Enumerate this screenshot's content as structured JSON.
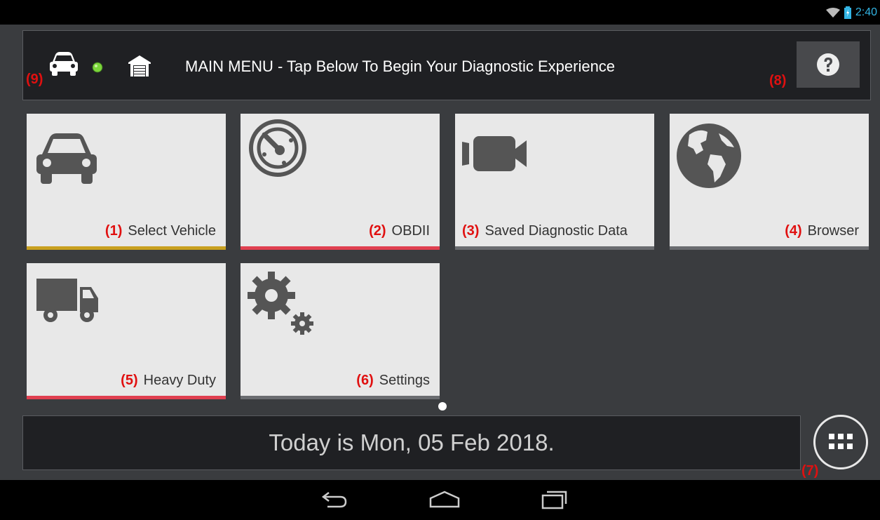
{
  "status_bar": {
    "time": "2:40",
    "icons": [
      "wifi-icon",
      "battery-icon"
    ]
  },
  "header": {
    "title": "MAIN MENU - Tap Below To Begin Your Diagnostic Experience",
    "status_led_color": "#7bd63a",
    "annotation_vehicle": "(9)",
    "annotation_help": "(8)",
    "help_icon": "question-icon"
  },
  "tiles": [
    {
      "number": "(1)",
      "label": "Select Vehicle",
      "icon": "car-icon",
      "accent": "#c8a020"
    },
    {
      "number": "(2)",
      "label": "OBDII",
      "icon": "gauge-icon",
      "accent": "#e04050"
    },
    {
      "number": "(3)",
      "label": "Saved Diagnostic Data",
      "icon": "video-camera-icon",
      "accent": "#6a6c70"
    },
    {
      "number": "(4)",
      "label": "Browser",
      "icon": "globe-icon",
      "accent": "#6a6c70"
    },
    {
      "number": "(5)",
      "label": "Heavy Duty",
      "icon": "truck-icon",
      "accent": "#e04050"
    },
    {
      "number": "(6)",
      "label": "Settings",
      "icon": "gears-icon",
      "accent": "#6a6c70"
    }
  ],
  "date_bar": {
    "text": "Today is Mon, 05 Feb 2018."
  },
  "apps_button": {
    "annotation": "(7)",
    "icon": "app-grid-icon"
  },
  "nav_bar": {
    "icons": [
      "back-icon",
      "home-icon",
      "recent-apps-icon"
    ]
  }
}
